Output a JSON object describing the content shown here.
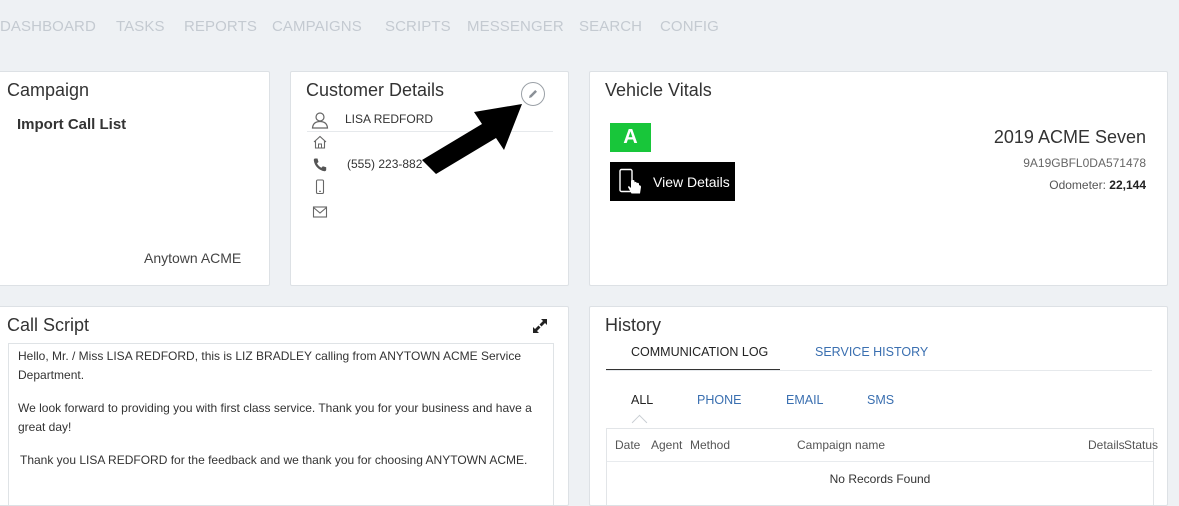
{
  "nav": {
    "items": [
      "DASHBOARD",
      "TASKS",
      "REPORTS",
      "CAMPAIGNS",
      "SCRIPTS",
      "MESSENGER",
      "SEARCH",
      "CONFIG"
    ]
  },
  "campaign": {
    "title": "Campaign",
    "name": "Import Call List",
    "store": "Anytown ACME"
  },
  "customer": {
    "title": "Customer Details",
    "name": "LISA REDFORD",
    "address": "",
    "phone": "(555) 223-882",
    "mobile": "",
    "email": ""
  },
  "vehicle": {
    "title": "Vehicle Vitals",
    "grade": "A",
    "view_details_label": "View Details",
    "model": "2019 ACME Seven",
    "vin": "9A19GBFL0DA571478",
    "odometer_label": "Odometer:",
    "odometer_value": "22,144",
    "grade_color": "#18c63a"
  },
  "script": {
    "title": "Call Script",
    "paragraphs": [
      "Hello, Mr. / Miss LISA REDFORD, this is LIZ BRADLEY calling from ANYTOWN ACME Service Department.",
      "We look forward to providing you with first class service. Thank you for your business and have a great day!",
      "Thank you LISA REDFORD for the feedback and we thank you for choosing ANYTOWN ACME."
    ]
  },
  "history": {
    "title": "History",
    "tabs": [
      "COMMUNICATION LOG",
      "SERVICE HISTORY"
    ],
    "sub_tabs": [
      "ALL",
      "PHONE",
      "EMAIL",
      "SMS"
    ],
    "columns": [
      "Date",
      "Agent",
      "Method",
      "Campaign name",
      "Details",
      "Status"
    ],
    "empty_message": "No Records Found"
  },
  "colors": {
    "link": "#3a6fb0",
    "nav_text": "#c4cad1",
    "background": "#eef1f4"
  }
}
